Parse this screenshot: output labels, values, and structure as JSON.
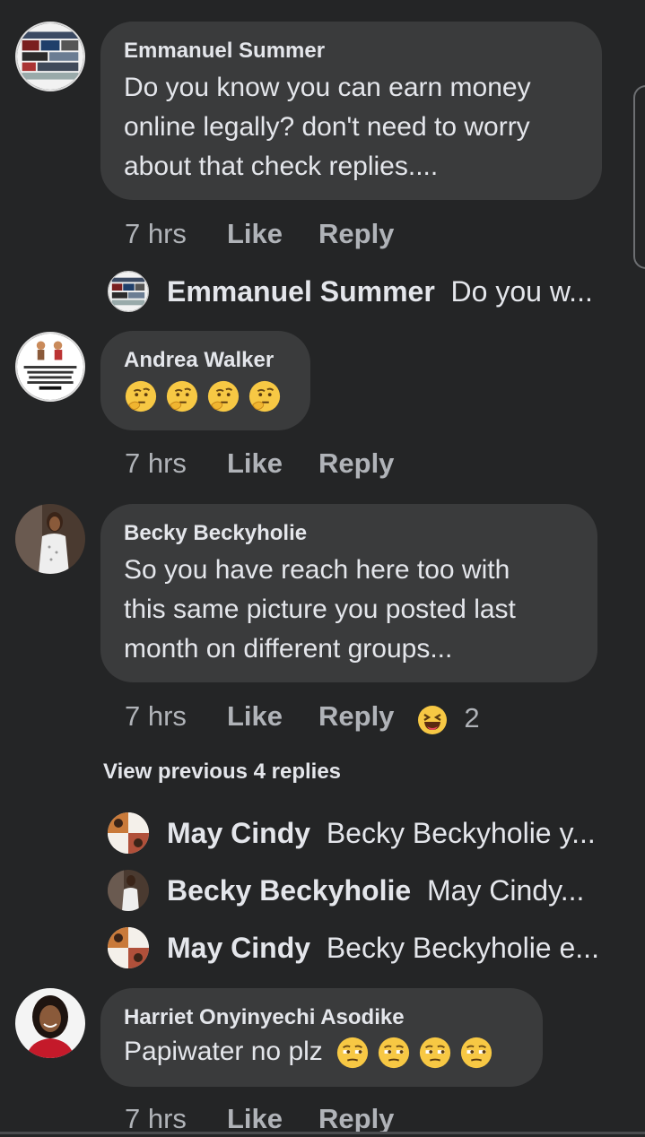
{
  "comments": [
    {
      "author": "Emmanuel Summer",
      "lines": [
        "Do you know you can earn money",
        "online legally? don't need to worry",
        "about that check replies...."
      ],
      "time": "7 hrs",
      "like": "Like",
      "reply": "Reply",
      "preview_reply": {
        "author": "Emmanuel Summer",
        "text": "Do you w..."
      }
    },
    {
      "author": "Andrea Walker",
      "emoji_name": "thinking-face",
      "emoji_count": 4,
      "time": "7 hrs",
      "like": "Like",
      "reply": "Reply",
      "avatar_text": "A time will come in your life when some people will regret why they treated you wrong. Trust me."
    },
    {
      "author": "Becky Beckyholie",
      "lines": [
        "So you have reach here too with",
        "this same picture you posted last",
        "month on different groups..."
      ],
      "time": "7 hrs",
      "like": "Like",
      "reply": "Reply",
      "reaction": {
        "type": "haha",
        "count": "2"
      }
    },
    {
      "author": "Harriet Onyinyechi Asodike",
      "text": "Papiwater no plz",
      "emoji_name": "unamused-face",
      "emoji_count": 4,
      "time": "7 hrs",
      "like": "Like",
      "reply": "Reply"
    }
  ],
  "view_previous": "View previous 4 replies",
  "replies": [
    {
      "author": "May Cindy",
      "text": "Becky Beckyholie y..."
    },
    {
      "author": "Becky Beckyholie",
      "text": "May Cindy..."
    },
    {
      "author": "May Cindy",
      "text": "Becky Beckyholie e..."
    }
  ],
  "colors": {
    "background": "#242526",
    "bubble": "#3a3b3c",
    "primary_text": "#e4e6eb",
    "secondary_text": "#b0b3b8"
  }
}
